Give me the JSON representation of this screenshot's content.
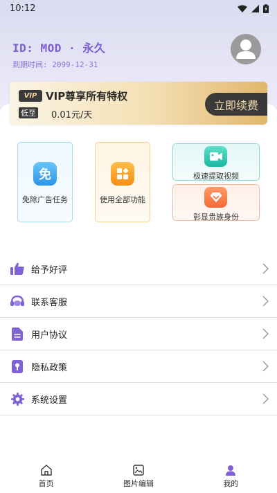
{
  "status_bar": {
    "time": "10:12"
  },
  "profile": {
    "id_text": "ID: MOD · 永久",
    "expire_text": "到期时间: 2099-12-31"
  },
  "vip": {
    "badge": "VIP",
    "title": "VIP尊享所有特权",
    "price_tag": "低至",
    "price": "0.01元/天",
    "renew_button": "立即续费"
  },
  "features": {
    "free_ads": {
      "label": "免除广告任务",
      "icon_char": "免",
      "icon": "free-icon"
    },
    "all_features": {
      "label": "使用全部功能",
      "icon": "grid-icon"
    },
    "extract_video": {
      "label": "极速提取视频",
      "icon": "video-icon"
    },
    "vip_identity": {
      "label": "彰显贵族身份",
      "icon": "diamond-icon"
    }
  },
  "menu": {
    "items": [
      {
        "label": "给予好评",
        "icon": "thumbs-up-icon"
      },
      {
        "label": "联系客服",
        "icon": "headset-icon"
      },
      {
        "label": "用户协议",
        "icon": "document-icon"
      },
      {
        "label": "隐私政策",
        "icon": "lock-icon"
      },
      {
        "label": "系统设置",
        "icon": "gear-icon"
      }
    ]
  },
  "bottom_nav": {
    "items": [
      {
        "label": "首页",
        "icon": "home-icon",
        "active": false
      },
      {
        "label": "图片编辑",
        "icon": "image-edit-icon",
        "active": false
      },
      {
        "label": "我的",
        "icon": "user-icon",
        "active": true
      }
    ]
  },
  "colors": {
    "accent": "#7b5fd0",
    "menu_icon": "#7f63d6",
    "vip_dark": "#3b3a39",
    "vip_gold": "#f3dcae"
  }
}
